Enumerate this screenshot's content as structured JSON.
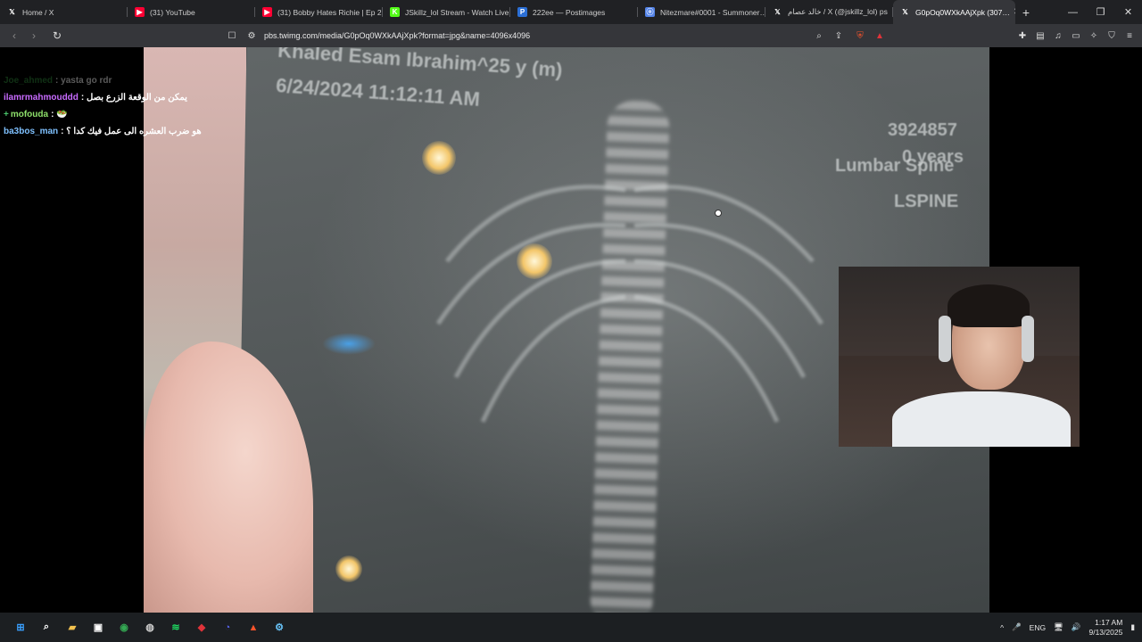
{
  "browser": {
    "tabs": [
      {
        "title": "Home / X",
        "favicon": "x-logo-icon",
        "color": "#000000"
      },
      {
        "title": "(31) YouTube",
        "favicon": "youtube-icon",
        "color": "#ff0033"
      },
      {
        "title": "(31) Bobby Hates Richie | Ep 2…",
        "favicon": "youtube-icon",
        "color": "#ff0033"
      },
      {
        "title": "JSkillz_lol Stream - Watch Live…",
        "favicon": "kick-icon",
        "color": "#53fc18"
      },
      {
        "title": "222ee — Postimages",
        "favicon": "postimages-icon",
        "color": "#2b6fd6"
      },
      {
        "title": "Nitezmare#0001 - Summoner…",
        "favicon": "opgg-icon",
        "color": "#5383e8"
      },
      {
        "title": "خالد عصام / X (@jskillz_lol) ps",
        "favicon": "x-logo-icon",
        "color": "#000000"
      },
      {
        "title": "G0pOq0WXkAAjXpk (307…",
        "favicon": "x-logo-icon",
        "color": "#000000",
        "active": true
      }
    ],
    "new_tab_label": "+",
    "url": "pbs.twimg.com/media/G0pOq0WXkAAjXpk?format=jpg&name=4096x4096",
    "window_controls": {
      "minimize": "—",
      "maximize": "❐",
      "close": "✕"
    }
  },
  "image": {
    "film_name": "Khaled Esam Ibrahim^25 y (m)",
    "film_date": "6/24/2024 11:12:11 AM",
    "film_id": "3924857",
    "film_age": "0 years",
    "film_region": "Lumbar Spine",
    "film_code": "LSPINE"
  },
  "chat": [
    {
      "user": "Joe_ahmed",
      "message": "yasta go rdr",
      "user_color": "#2e8b3a",
      "faded": true
    },
    {
      "user": "ilamrmahmouddd",
      "message": "يمكن من الوقعة الزرع بصل",
      "user_color": "#c86bff"
    },
    {
      "user": "mofouda",
      "message": "🥗",
      "user_color": "#8ee06b",
      "badge": "+"
    },
    {
      "user": "ba3bos_man",
      "message": "هو ضرب العشره الى عمل فيك كدا ؟",
      "user_color": "#7fc1ff"
    }
  ],
  "taskbar": {
    "apps": [
      {
        "name": "start-icon",
        "glyph": "⊞",
        "color": "#3aa0ff"
      },
      {
        "name": "search-icon",
        "glyph": "⌕",
        "color": "#ffffff"
      },
      {
        "name": "file-explorer-icon",
        "glyph": "▰",
        "color": "#f2c14e"
      },
      {
        "name": "store-icon",
        "glyph": "▣",
        "color": "#ffffff"
      },
      {
        "name": "chrome-icon",
        "glyph": "◉",
        "color": "#34a853"
      },
      {
        "name": "obs-icon",
        "glyph": "◍",
        "color": "#cccccc"
      },
      {
        "name": "spotify-icon",
        "glyph": "≋",
        "color": "#1ed760"
      },
      {
        "name": "app-red-icon",
        "glyph": "◆",
        "color": "#e0333a"
      },
      {
        "name": "discord-icon",
        "glyph": "◔",
        "color": "#5865f2"
      },
      {
        "name": "brave-icon",
        "glyph": "▲",
        "color": "#fb542b"
      },
      {
        "name": "steam-icon",
        "glyph": "⚙",
        "color": "#66c0f4"
      }
    ],
    "tray": {
      "chevron": "^",
      "mic": "🎤",
      "language": "ENG",
      "time": "1:17 AM",
      "date": "9/13/2025"
    }
  }
}
